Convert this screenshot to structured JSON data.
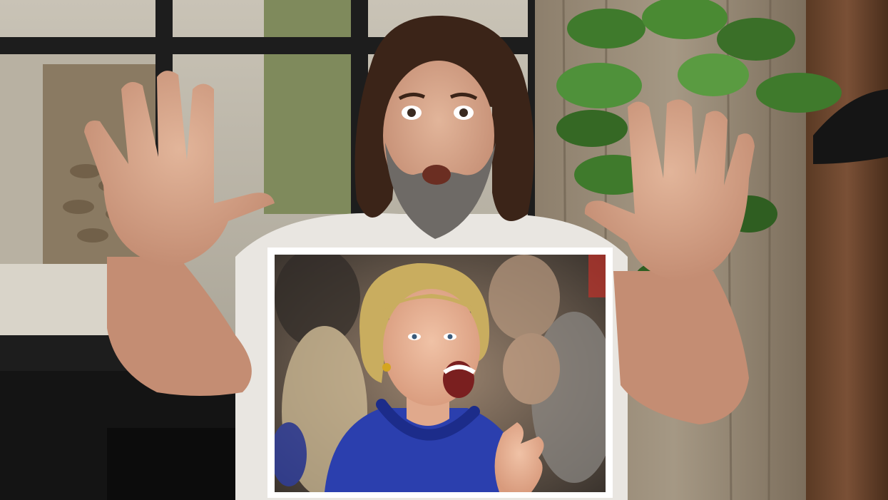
{
  "image": {
    "kind": "video-frame-with-inset-photo",
    "main_scene": {
      "subject": "man-with-long-curly-hair-and-beard",
      "pose": "both-hands-raised-palms-out",
      "setting": "indoor-room-with-window-plant-and-curtain"
    },
    "inset_photo": {
      "subject": "woman-with-blonde-hair-laughing",
      "clothing": "blue-jacket-with-beaded-necklace",
      "background": "blurred-crowd"
    }
  },
  "colors": {
    "inset_border": "#ffffff",
    "jacket_blue": "#2b3fae",
    "plant_green": "#3f7a2c",
    "shirt_white": "#e9e6e1"
  }
}
